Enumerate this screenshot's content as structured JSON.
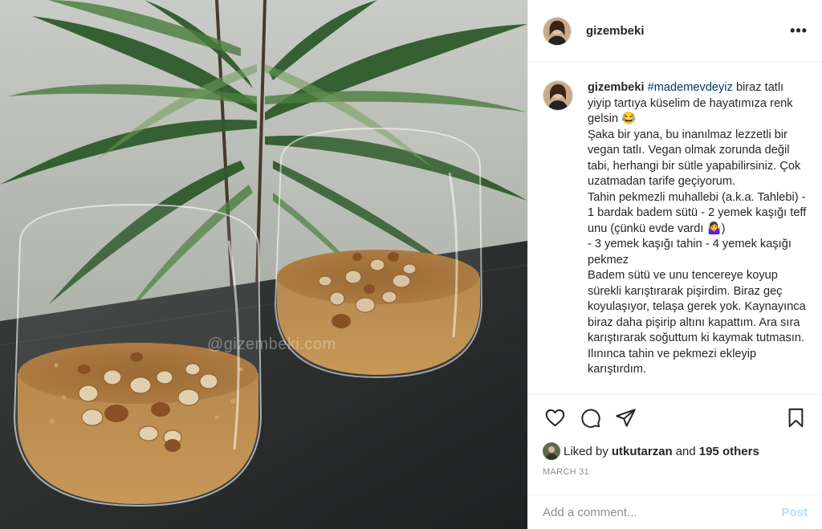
{
  "photo": {
    "alt_watermark": "@gizembeki.com"
  },
  "header": {
    "username": "gizembeki",
    "more_label": "•••"
  },
  "caption": {
    "username": "gizembeki",
    "hashtag": "#mademevdeyiz",
    "first_line": "biraz tatlı yiyip tartıya küselim de hayatımıza renk gelsin 😂",
    "lines": [
      "Şaka bir yana, bu inanılmaz lezzetli bir vegan tatlı. Vegan olmak zorunda değil tabi, herhangi bir sütle yapabilirsiniz. Çok uzatmadan tarife geçiyorum.",
      "Tahin pekmezli muhallebi (a.k.a. Tahlebi) - 1 bardak badem sütü - 2 yemek kaşığı teff unu (çünkü evde vardı 🤷‍♀️)",
      "- 3 yemek kaşığı tahin - 4 yemek kaşığı pekmez",
      "Badem sütü ve unu tencereye koyup sürekli karıştırarak pişirdim. Biraz geç koyulaşıyor, telaşa gerek yok. Kaynayınca biraz daha pişirip altını kapattım. Ara sıra karıştırarak soğuttum ki kaymak tutmasın. Ilınınca tahin ve pekmezi ekleyip karıştırdım."
    ]
  },
  "likes": {
    "prefix": "Liked by",
    "user": "utkutarzan",
    "connector": "and",
    "others": "195 others"
  },
  "date": "MARCH 31",
  "comment": {
    "placeholder": "Add a comment...",
    "post_label": "Post"
  },
  "colors": {
    "link": "#00376b",
    "post_disabled": "#b2dffc",
    "muted": "#8e8e8e"
  }
}
